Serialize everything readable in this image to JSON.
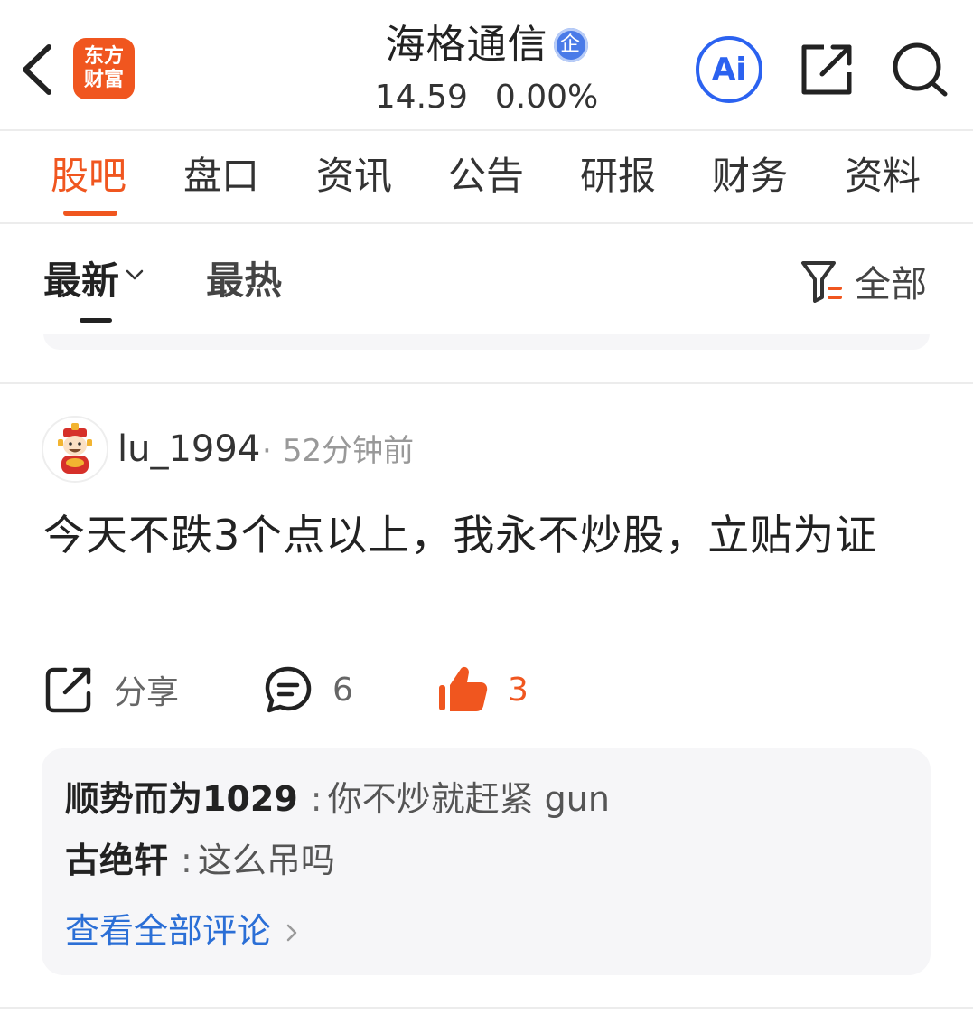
{
  "header": {
    "logo_line1": "东方",
    "logo_line2": "财富",
    "stock_name": "海格通信",
    "badge": "企",
    "price": "14.59",
    "change_pct": "0.00%",
    "ai_label": "Ai"
  },
  "tabs": [
    {
      "label": "股吧",
      "active": true
    },
    {
      "label": "盘口"
    },
    {
      "label": "资讯"
    },
    {
      "label": "公告"
    },
    {
      "label": "研报"
    },
    {
      "label": "财务"
    },
    {
      "label": "资料"
    }
  ],
  "filter": {
    "sort_latest": "最新",
    "sort_hot": "最热",
    "filter_label": "全部"
  },
  "post": {
    "username": "lu_1994",
    "time": "52分钟前",
    "content": "今天不跌3个点以上，我永不炒股，立贴为证",
    "share_label": "分享",
    "comment_count": "6",
    "like_count": "3",
    "comments": [
      {
        "user": "顺势而为1029",
        "text": "你不炒就赶紧 gun"
      },
      {
        "user": "古绝轩",
        "text": "这么吊吗"
      }
    ],
    "view_all_label": "查看全部评论"
  },
  "colors": {
    "accent": "#f0561f",
    "ai_blue": "#2b62f0",
    "link_blue": "#2b6fd6"
  }
}
